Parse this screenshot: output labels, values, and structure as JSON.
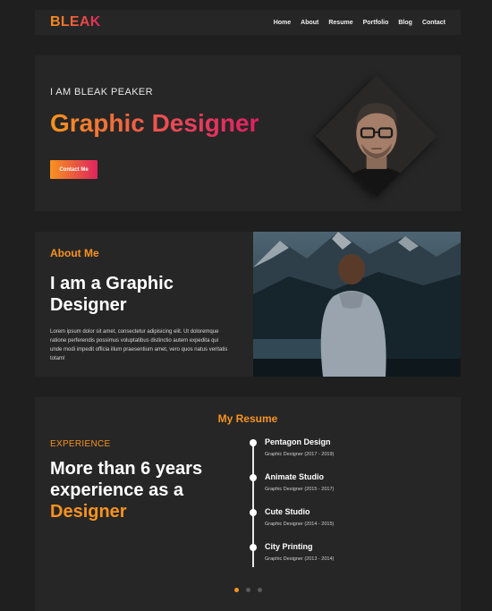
{
  "brand": {
    "logo": "BLEAK",
    "gradient_start": "#f7931e",
    "gradient_end": "#e0245e"
  },
  "nav": {
    "items": [
      "Home",
      "About",
      "Resume",
      "Portfolio",
      "Blog",
      "Contact"
    ]
  },
  "hero": {
    "intro": "I AM BLEAK PEAKER",
    "role": "Graphic Designer",
    "cta_label": "Contact Me"
  },
  "about": {
    "label": "About Me",
    "heading": "I am a Graphic Designer",
    "paragraph": "Lorem ipsum dolor sit amet, consectetur adipisicing elit. Ut doloremque ratione perferendis possimus voluptatibus distinctio autem expedita qui unde modi impedit officia illum praesentium amet, vero quos natus veritatis totam!"
  },
  "resume": {
    "title": "My Resume",
    "experience_label": "EXPERIENCE",
    "heading_main": "More than 6 years experience as a",
    "heading_accent": "Designer",
    "timeline": [
      {
        "company": "Pentagon Design",
        "role": "Graphic Designer (2017 - 2019)"
      },
      {
        "company": "Animate Studio",
        "role": "Graphic Designer (2015 - 2017)"
      },
      {
        "company": "Cute Studio",
        "role": "Graphic Designer (2014 - 2015)"
      },
      {
        "company": "City Printing",
        "role": "Graphic Designer (2013 - 2014)"
      }
    ],
    "pager": {
      "count": 3,
      "active": 1
    }
  },
  "colors": {
    "background": "#1f1f1f",
    "panel": "#262626",
    "accent": "#f7931e"
  }
}
